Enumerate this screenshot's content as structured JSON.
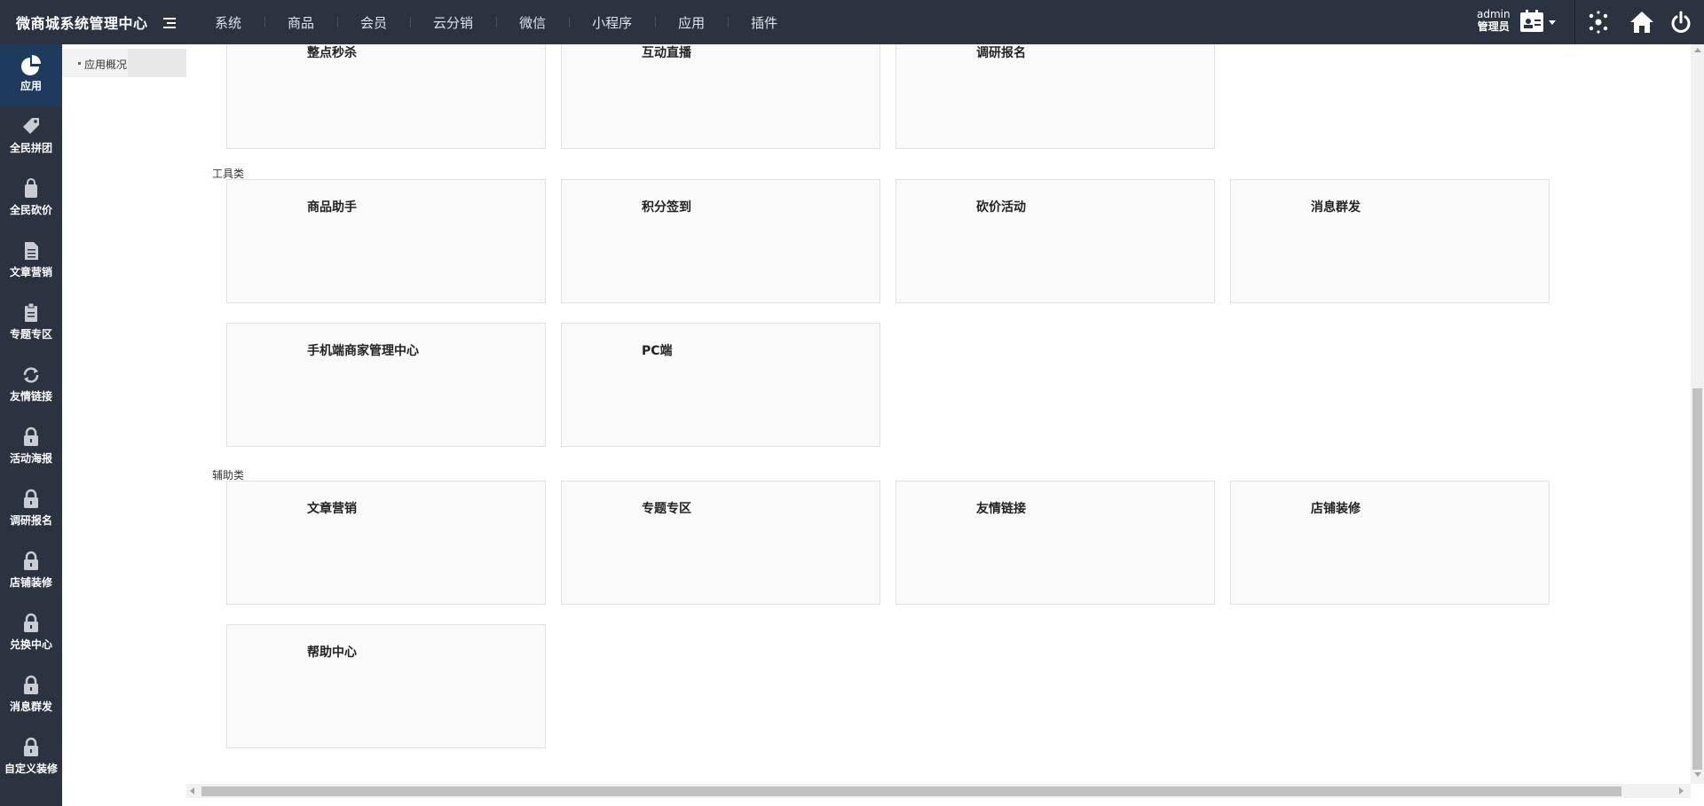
{
  "header": {
    "brand": "微商城系统管理中心",
    "nav": [
      "系统",
      "商品",
      "会员",
      "云分销",
      "微信",
      "小程序",
      "应用",
      "插件"
    ],
    "user_name": "admin",
    "user_role": "管理员"
  },
  "sidebar": {
    "items": [
      {
        "label": "应用",
        "icon": "pie-chart-icon",
        "active": true
      },
      {
        "label": "全民拼团",
        "icon": "tag-icon"
      },
      {
        "label": "全民砍价",
        "icon": "shopping-bag-icon"
      },
      {
        "label": "文章营销",
        "icon": "document-icon"
      },
      {
        "label": "专题专区",
        "icon": "clipboard-icon"
      },
      {
        "label": "友情链接",
        "icon": "refresh-link-icon"
      },
      {
        "label": "活动海报",
        "icon": "lock-icon"
      },
      {
        "label": "调研报名",
        "icon": "lock-icon"
      },
      {
        "label": "店铺装修",
        "icon": "lock-icon"
      },
      {
        "label": "兑换中心",
        "icon": "lock-icon"
      },
      {
        "label": "消息群发",
        "icon": "lock-icon"
      },
      {
        "label": "自定义装修",
        "icon": "lock-icon"
      }
    ]
  },
  "subsidebar": {
    "item": "应用概况"
  },
  "sections": {
    "top_row": [
      "整点秒杀",
      "互动直播",
      "调研报名"
    ],
    "tools": {
      "label": "工具类",
      "cards": [
        "商品助手",
        "积分签到",
        "砍价活动",
        "消息群发",
        "手机端商家管理中心",
        "PC端"
      ]
    },
    "aux": {
      "label": "辅助类",
      "cards": [
        "文章营销",
        "专题专区",
        "友情链接",
        "店铺装修",
        "帮助中心"
      ]
    }
  }
}
